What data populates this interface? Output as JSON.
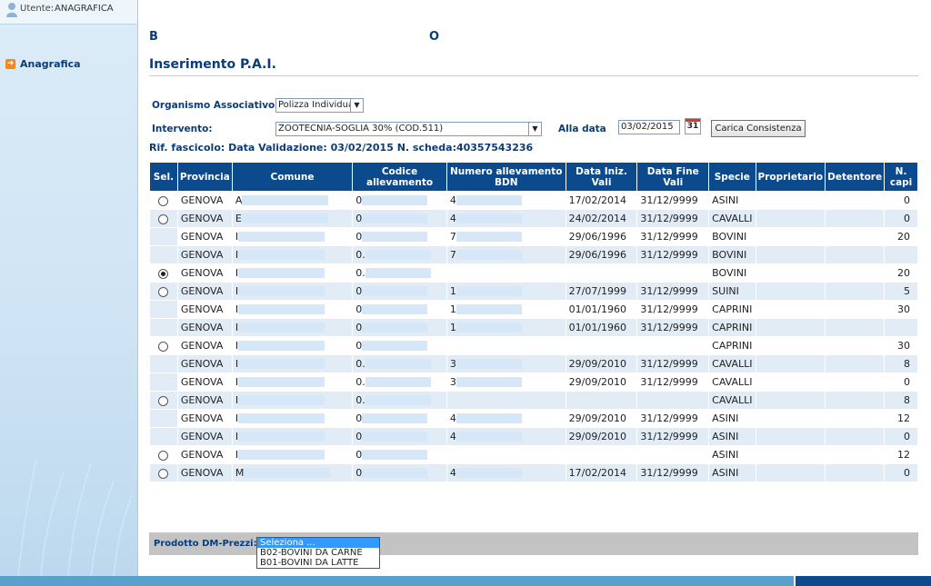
{
  "sidebar": {
    "user_label": "Utente:",
    "user_name": "ANAGRAFICA",
    "nav_items": [
      {
        "label": "Anagrafica",
        "icon": "arrow-right-icon"
      }
    ]
  },
  "header": {
    "title_start": "B",
    "title_end": "O"
  },
  "page_title": "Inserimento P.A.I.",
  "form": {
    "organismo_label": "Organismo Associativo:",
    "organismo_value": "Polizza Individuale",
    "intervento_label": "Intervento:",
    "intervento_value": "ZOOTECNIA-SOGLIA 30% (COD.511)",
    "alla_data_label": "Alla data",
    "alla_data_value": "03/02/2015",
    "calendar_icon_text": "31",
    "load_button": "Carica Consistenza"
  },
  "rif_text": "Rif. fascicolo: Data Validazione: 03/02/2015 N. scheda:40357543236",
  "table": {
    "headers": [
      "Sel.",
      "Provincia",
      "Comune",
      "Codice allevamento",
      "Numero allevamento BDN",
      "Data Iniz. Vali",
      "Data Fine Vali",
      "Specie",
      "Proprietario",
      "Detentore",
      "N. capi"
    ],
    "rows": [
      {
        "radio": "off",
        "provincia": "GENOVA",
        "comune": "A",
        "codice": "0",
        "bdn": "4",
        "inizio": "17/02/2014",
        "fine": "31/12/9999",
        "specie": "ASINI",
        "capi": "0"
      },
      {
        "radio": "off",
        "provincia": "GENOVA",
        "comune": "E",
        "codice": "0",
        "bdn": "4",
        "inizio": "24/02/2014",
        "fine": "31/12/9999",
        "specie": "CAVALLI",
        "capi": "0"
      },
      {
        "radio": "",
        "provincia": "GENOVA",
        "comune": "I",
        "codice": "0",
        "bdn": "7",
        "inizio": "29/06/1996",
        "fine": "31/12/9999",
        "specie": "BOVINI",
        "capi": "20"
      },
      {
        "radio": "",
        "provincia": "GENOVA",
        "comune": "I",
        "codice": "0.",
        "bdn": "7",
        "inizio": "29/06/1996",
        "fine": "31/12/9999",
        "specie": "BOVINI",
        "capi": ""
      },
      {
        "radio": "on",
        "provincia": "GENOVA",
        "comune": "I",
        "codice": "0.",
        "bdn": "",
        "inizio": "",
        "fine": "",
        "specie": "BOVINI",
        "capi": "20"
      },
      {
        "radio": "off",
        "provincia": "GENOVA",
        "comune": "I",
        "codice": "0",
        "bdn": "1",
        "inizio": "27/07/1999",
        "fine": "31/12/9999",
        "specie": "SUINI",
        "capi": "5"
      },
      {
        "radio": "",
        "provincia": "GENOVA",
        "comune": "I",
        "codice": "0",
        "bdn": "1",
        "inizio": "01/01/1960",
        "fine": "31/12/9999",
        "specie": "CAPRINI",
        "capi": "30"
      },
      {
        "radio": "",
        "provincia": "GENOVA",
        "comune": "I",
        "codice": "0",
        "bdn": "1",
        "inizio": "01/01/1960",
        "fine": "31/12/9999",
        "specie": "CAPRINI",
        "capi": ""
      },
      {
        "radio": "off",
        "provincia": "GENOVA",
        "comune": "I",
        "codice": "0",
        "bdn": "",
        "inizio": "",
        "fine": "",
        "specie": "CAPRINI",
        "capi": "30"
      },
      {
        "radio": "",
        "provincia": "GENOVA",
        "comune": "I",
        "codice": "0.",
        "bdn": "3",
        "inizio": "29/09/2010",
        "fine": "31/12/9999",
        "specie": "CAVALLI",
        "capi": "8"
      },
      {
        "radio": "",
        "provincia": "GENOVA",
        "comune": "I",
        "codice": "0.",
        "bdn": "3",
        "inizio": "29/09/2010",
        "fine": "31/12/9999",
        "specie": "CAVALLI",
        "capi": "0"
      },
      {
        "radio": "off",
        "provincia": "GENOVA",
        "comune": "I",
        "codice": "0.",
        "bdn": "",
        "inizio": "",
        "fine": "",
        "specie": "CAVALLI",
        "capi": "8"
      },
      {
        "radio": "",
        "provincia": "GENOVA",
        "comune": "I",
        "codice": "0",
        "bdn": "4",
        "inizio": "29/09/2010",
        "fine": "31/12/9999",
        "specie": "ASINI",
        "capi": "12"
      },
      {
        "radio": "",
        "provincia": "GENOVA",
        "comune": "I",
        "codice": "0",
        "bdn": "4",
        "inizio": "29/09/2010",
        "fine": "31/12/9999",
        "specie": "ASINI",
        "capi": "0"
      },
      {
        "radio": "off",
        "provincia": "GENOVA",
        "comune": "I",
        "codice": "0",
        "bdn": "",
        "inizio": "",
        "fine": "",
        "specie": "ASINI",
        "capi": "12"
      },
      {
        "radio": "off",
        "provincia": "GENOVA",
        "comune": "M",
        "codice": "0",
        "bdn": "4",
        "inizio": "17/02/2014",
        "fine": "31/12/9999",
        "specie": "ASINI",
        "capi": "0"
      }
    ]
  },
  "prodotto": {
    "label": "Prodotto DM-Prezzi:",
    "options": [
      "Seleziona ...",
      "B02-BOVINI DA CARNE",
      "B01-BOVINI DA LATTE"
    ],
    "selected_index": 0
  },
  "colors": {
    "brand_dark": "#0b4a8c",
    "row_alt": "#e1ecf6",
    "accent_orange": "#f08a1e"
  }
}
